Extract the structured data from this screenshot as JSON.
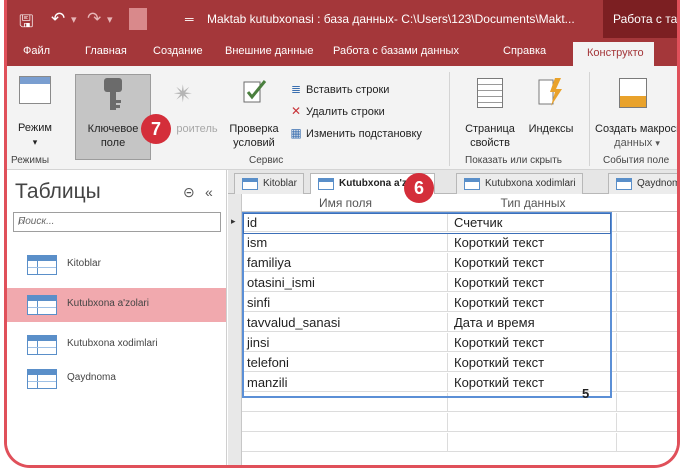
{
  "titlebar": {
    "title": "Maktab kutubxonasi : база данных- C:\\Users\\123\\Documents\\Makt...",
    "context_tab": "Работа с табли"
  },
  "ribbon_tabs": [
    "Файл",
    "Главная",
    "Создание",
    "Внешние данные",
    "Работа с базами данных",
    "Справка",
    "Конструкто"
  ],
  "ribbon": {
    "mode_btn": "Режим",
    "key_btn_line1": "Ключевое",
    "key_btn_line2": "поле",
    "builder_btn": "роитель",
    "check_btn_line1": "Проверка",
    "check_btn_line2": "условий",
    "insert_rows": "Вставить строки",
    "delete_rows": "Удалить строки",
    "change_lookup": "Изменить подстановку",
    "property_sheet_line1": "Страница",
    "property_sheet_line2": "свойств",
    "indexes_btn": "Индексы",
    "create_macros_line1": "Создать макросы",
    "create_macros_line2": "данных",
    "groups": {
      "modes": "Режимы",
      "service": "Сервис",
      "show_hide": "Показать или скрыть",
      "events": "События поле"
    }
  },
  "badges": {
    "key_badge": "7",
    "grid_badge": "6"
  },
  "nav": {
    "header": "Таблицы",
    "search_placeholder": "Поиск...",
    "items": [
      "Kitoblar",
      "Kutubxona a'zolari",
      "Kutubxona xodimlari",
      "Qaydnoma"
    ],
    "selected_index": 1
  },
  "doc_tabs": [
    "Kitoblar",
    "Kutubxona a'zolari",
    "Kutubxona xodimlari",
    "Qaydnoma"
  ],
  "grid": {
    "col_field": "Имя поля",
    "col_type": "Тип данных",
    "rows": [
      {
        "field": "id",
        "type": "Счетчик"
      },
      {
        "field": "ism",
        "type": "Короткий текст"
      },
      {
        "field": "familiya",
        "type": "Короткий текст"
      },
      {
        "field": "otasini_ismi",
        "type": "Короткий текст"
      },
      {
        "field": "sinfi",
        "type": "Короткий текст"
      },
      {
        "field": "tavvalud_sanasi",
        "type": "Дата и время"
      },
      {
        "field": "jinsi",
        "type": "Короткий текст"
      },
      {
        "field": "telefoni",
        "type": "Короткий текст"
      },
      {
        "field": "manzili",
        "type": "Короткий текст"
      }
    ],
    "annotation_number": "5"
  },
  "colors": {
    "access_red": "#a4373a",
    "badge_red": "#d42e3a",
    "selection_pink": "#f1a9ae",
    "highlight_blue": "#5b8fd6"
  }
}
